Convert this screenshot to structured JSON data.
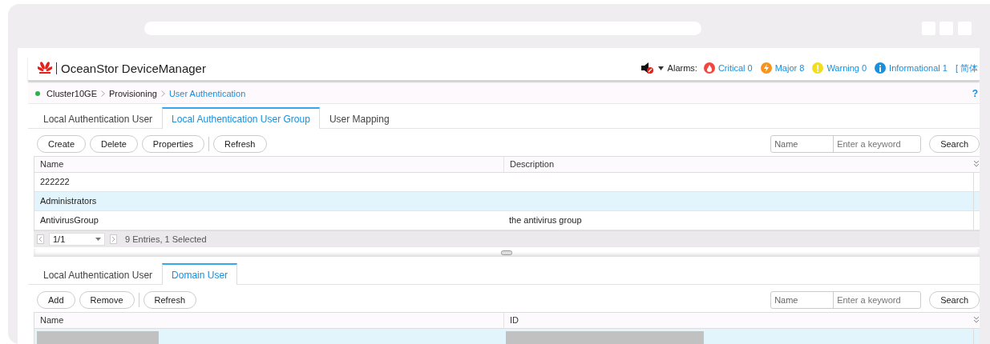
{
  "app": {
    "title": "OceanStor DeviceManager"
  },
  "alarms": {
    "label": "Alarms:",
    "items": [
      {
        "kind": "critical",
        "text": "Critical 0",
        "color": "#f2453d"
      },
      {
        "kind": "major",
        "text": "Major 8",
        "color": "#f7941d"
      },
      {
        "kind": "warning",
        "text": "Warning 0",
        "color": "#f1de20"
      },
      {
        "kind": "informational",
        "text": "Informational 1",
        "color": "#1a8fdc"
      }
    ]
  },
  "language": "[ 简体",
  "breadcrumb": [
    {
      "text": "Cluster10GE",
      "current": false
    },
    {
      "text": "Provisioning",
      "current": false
    },
    {
      "text": "User Authentication",
      "current": true
    }
  ],
  "help": "?",
  "panels": [
    {
      "tabs": [
        {
          "label": "Local Authentication User",
          "selected": false
        },
        {
          "label": "Local Authentication User Group",
          "selected": true
        },
        {
          "label": "User Mapping",
          "selected": false
        }
      ],
      "toolbar": [
        [
          "Create",
          "Delete",
          "Properties"
        ],
        [
          "Refresh"
        ]
      ],
      "search": {
        "field": "Name",
        "placeholder": "Enter a keyword",
        "button": "Search"
      },
      "table": {
        "columns": [
          "Name",
          "Description"
        ],
        "rows": [
          {
            "cells": [
              "222222"
            ],
            "selected": false
          },
          {
            "cells": [
              "Administrators"
            ],
            "selected": true
          },
          {
            "cells": [
              "AntivirusGroup",
              "the antivirus group"
            ],
            "selected": false
          }
        ]
      },
      "pager": {
        "page": "1/1",
        "summary": "9 Entries, 1 Selected"
      }
    },
    {
      "tabs": [
        {
          "label": "Local Authentication User",
          "selected": false
        },
        {
          "label": "Domain User",
          "selected": true
        }
      ],
      "toolbar": [
        [
          "Add",
          "Remove"
        ],
        [
          "Refresh"
        ]
      ],
      "search": {
        "field": "Name",
        "placeholder": "Enter a keyword",
        "button": "Search"
      },
      "table": {
        "columns": [
          "Name",
          "ID"
        ],
        "rows": [
          {
            "redacted": true,
            "selected": true
          }
        ]
      }
    }
  ]
}
